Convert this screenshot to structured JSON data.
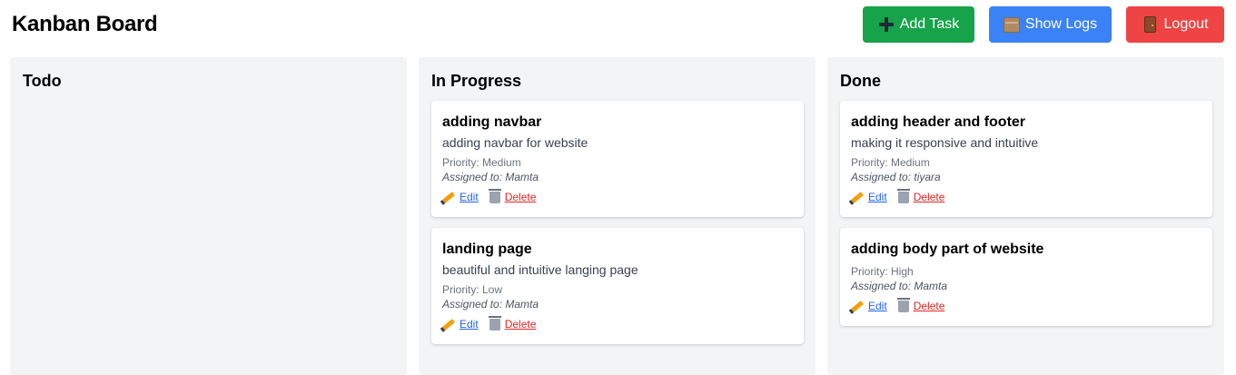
{
  "header": {
    "title": "Kanban Board",
    "add_task_label": "Add Task",
    "show_logs_label": "Show Logs",
    "logout_label": "Logout"
  },
  "colors": {
    "add_task": "#16a34a",
    "show_logs": "#3b82f6",
    "logout": "#ef4444",
    "column_bg": "#f3f4f6"
  },
  "columns": [
    {
      "title": "Todo",
      "cards": []
    },
    {
      "title": "In Progress",
      "cards": [
        {
          "title": "adding navbar",
          "description": "adding navbar for website",
          "priority": "Priority: Medium",
          "assigned": "Assigned to: Mamta",
          "edit_label": "Edit",
          "delete_label": "Delete"
        },
        {
          "title": "landing page",
          "description": "beautiful and intuitive langing page",
          "priority": "Priority: Low",
          "assigned": "Assigned to: Mamta",
          "edit_label": "Edit",
          "delete_label": "Delete"
        }
      ]
    },
    {
      "title": "Done",
      "cards": [
        {
          "title": "adding header and footer",
          "description": "making it responsive and intuitive",
          "priority": "Priority: Medium",
          "assigned": "Assigned to: tiyara",
          "edit_label": "Edit",
          "delete_label": "Delete"
        },
        {
          "title": "adding body part of website",
          "description": "",
          "priority": "Priority: High",
          "assigned": "Assigned to: Mamta",
          "edit_label": "Edit",
          "delete_label": "Delete"
        }
      ]
    }
  ]
}
